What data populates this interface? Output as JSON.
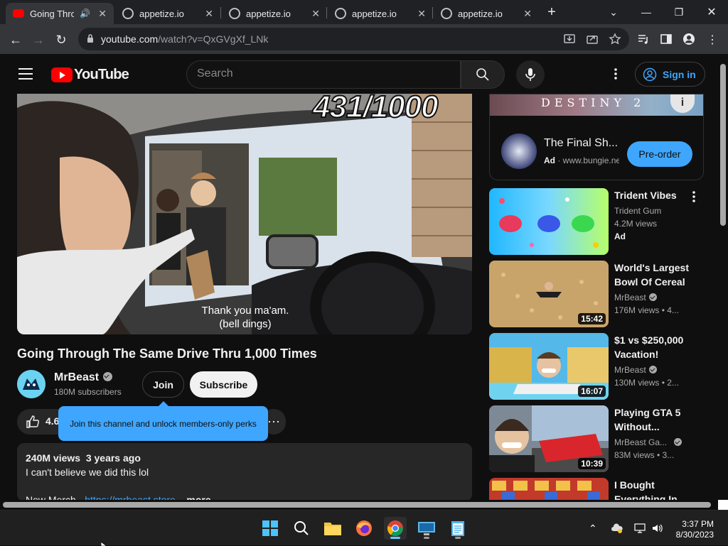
{
  "browser": {
    "tabs": [
      {
        "title": "Going Through",
        "active": true,
        "audio": true
      },
      {
        "title": "appetize.io",
        "active": false
      },
      {
        "title": "appetize.io",
        "active": false
      },
      {
        "title": "appetize.io",
        "active": false
      },
      {
        "title": "appetize.io",
        "active": false
      }
    ],
    "url_host": "youtube.com",
    "url_path": "/watch?v=QxGVgXf_LNk"
  },
  "youtube": {
    "logo_text": "YouTube",
    "search_placeholder": "Search",
    "sign_in_label": "Sign in"
  },
  "video": {
    "overlay_counter": "431/1000",
    "caption_line1": "Thank you ma'am.",
    "caption_line2": "(bell dings)",
    "title": "Going Through The Same Drive Thru 1,000 Times",
    "channel_name": "MrBeast",
    "subscribers": "180M subscribers",
    "join_label": "Join",
    "subscribe_label": "Subscribe",
    "like_count": "4.6",
    "join_tooltip": "Join this channel and unlock members-only perks",
    "views_date": "240M views  3 years ago",
    "description_line1": "I can't believe we did this lol",
    "description_line2_prefix": "New Merch - ",
    "description_link": "https://mrbeast.store",
    "description_more": "...more"
  },
  "ad": {
    "banner_text": "DESTINY 2",
    "title": "The Final Sh...",
    "label": "Ad",
    "domain": "www.bungie.net",
    "cta": "Pre-order"
  },
  "recommendations": [
    {
      "title_line1": "Trident Vibes",
      "title_line2": "",
      "channel": "Trident Gum",
      "meta": "4.2M views",
      "badge": "Ad",
      "duration": "",
      "verified": false
    },
    {
      "title_line1": "World's Largest",
      "title_line2": "Bowl Of Cereal",
      "channel": "MrBeast",
      "meta": "176M views  • 4...",
      "badge": "",
      "duration": "15:42",
      "verified": true
    },
    {
      "title_line1": "$1 vs $250,000",
      "title_line2": "Vacation!",
      "channel": "MrBeast",
      "meta": "130M views  • 2...",
      "badge": "",
      "duration": "16:07",
      "verified": true
    },
    {
      "title_line1": "Playing GTA 5",
      "title_line2": "Without...",
      "channel": "MrBeast Ga...",
      "meta": "83M views  • 3...",
      "badge": "",
      "duration": "10:39",
      "verified": true
    },
    {
      "title_line1": "I Bought",
      "title_line2": "Everything In...",
      "channel": "",
      "meta": "",
      "badge": "",
      "duration": "",
      "verified": false
    }
  ],
  "taskbar": {
    "time": "3:37 PM",
    "date": "8/30/2023",
    "apps": [
      "windows-start",
      "search",
      "file-explorer",
      "firefox",
      "chrome",
      "remote-desktop",
      "notepad"
    ]
  }
}
